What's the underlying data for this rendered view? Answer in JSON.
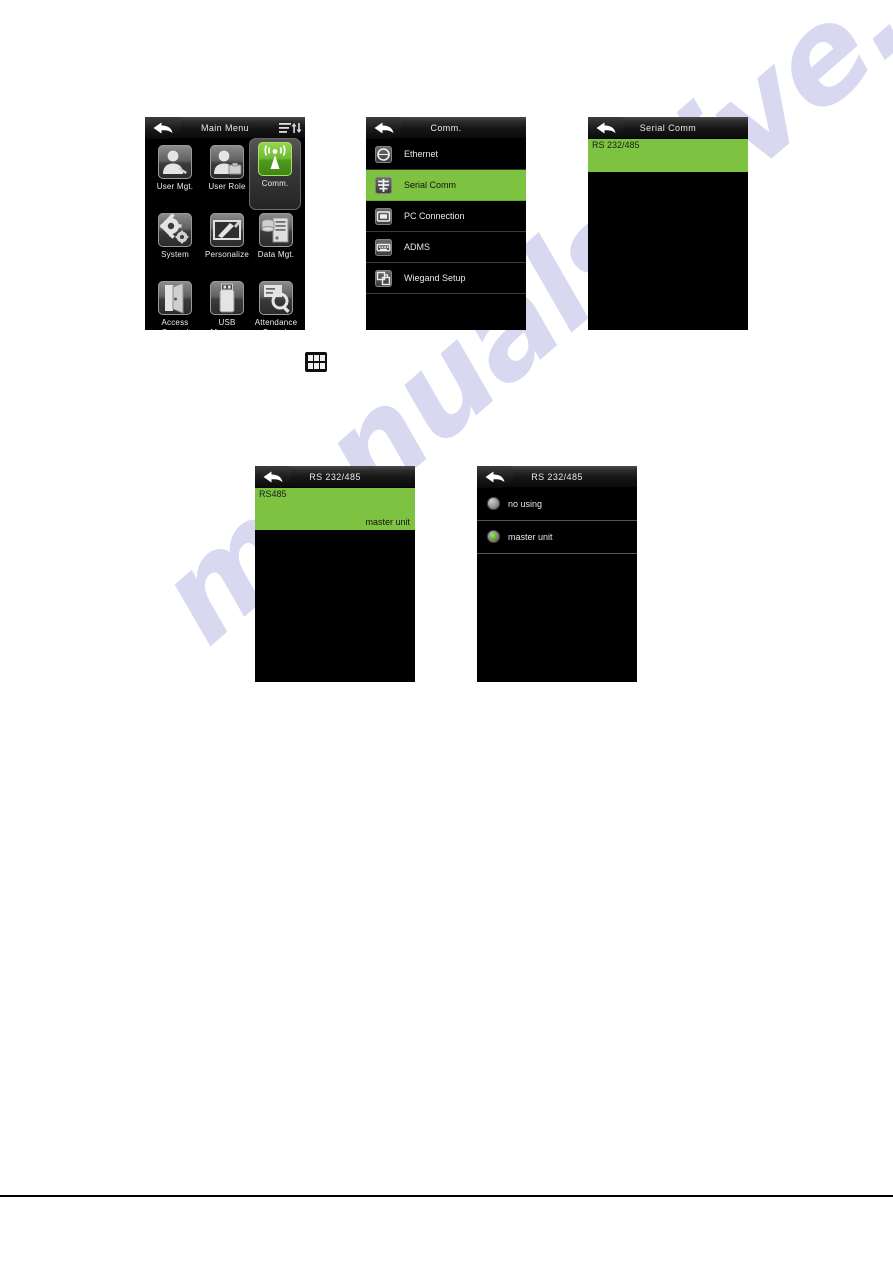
{
  "page": {
    "background_color": "#ffffff",
    "watermark_text": "manualshive.com",
    "watermark_color": "#b9bbe4"
  },
  "theme": {
    "accent_green": "#7ec242",
    "screen_black": "#000000",
    "header_dark": "#1d1d1d",
    "text_light": "#e9e9e9"
  },
  "panels": {
    "main_menu": {
      "title": "Main Menu",
      "back_icon": "back-arrow-icon",
      "sort_icon": "sort-lines-icon",
      "tiles": [
        {
          "label": "User Mgt.",
          "icon": "user-management-icon",
          "selected": false
        },
        {
          "label": "User Role",
          "icon": "user-role-icon",
          "selected": false
        },
        {
          "label": "Comm.",
          "icon": "communication-antenna-icon",
          "selected": true
        },
        {
          "label": "System",
          "icon": "system-gears-icon",
          "selected": false
        },
        {
          "label": "Personalize",
          "icon": "personalize-pen-icon",
          "selected": false
        },
        {
          "label": "Data Mgt.",
          "icon": "data-management-icon",
          "selected": false
        },
        {
          "label": "Access Control",
          "icon": "access-control-door-icon",
          "selected": false
        },
        {
          "label": "USB Manager",
          "icon": "usb-drive-icon",
          "selected": false
        },
        {
          "label": "Attendance Search",
          "icon": "attendance-search-icon",
          "selected": false
        }
      ]
    },
    "comm": {
      "title": "Comm.",
      "back_icon": "back-arrow-icon",
      "items": [
        {
          "label": "Ethernet",
          "icon": "ethernet-icon",
          "selected": false
        },
        {
          "label": "Serial Comm",
          "icon": "serial-comm-icon",
          "selected": true
        },
        {
          "label": "PC Connection",
          "icon": "pc-connection-icon",
          "selected": false
        },
        {
          "label": "ADMS",
          "icon": "adms-server-icon",
          "selected": false
        },
        {
          "label": "Wiegand Setup",
          "icon": "wiegand-setup-icon",
          "selected": false
        }
      ]
    },
    "serial_comm": {
      "title": "Serial Comm",
      "back_icon": "back-arrow-icon",
      "items": [
        {
          "label": "RS 232/485",
          "selected": true
        }
      ]
    },
    "rs232485_value": {
      "title": "RS 232/485",
      "back_icon": "back-arrow-icon",
      "setting_label": "RS485",
      "setting_value": "master unit"
    },
    "rs232485_options": {
      "title": "RS 232/485",
      "back_icon": "back-arrow-icon",
      "options": [
        {
          "label": "no using",
          "selected": false
        },
        {
          "label": "master unit",
          "selected": true
        }
      ]
    }
  },
  "standalone_icon": {
    "name": "app-grid-icon",
    "dots": 6
  }
}
